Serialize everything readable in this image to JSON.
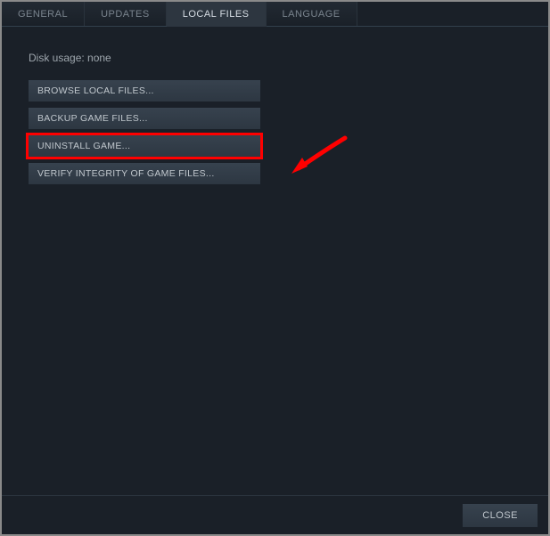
{
  "tabs": {
    "general": "GENERAL",
    "updates": "UPDATES",
    "local_files": "LOCAL FILES",
    "language": "LANGUAGE"
  },
  "disk_usage_label": "Disk usage: none",
  "buttons": {
    "browse": "BROWSE LOCAL FILES...",
    "backup": "BACKUP GAME FILES...",
    "uninstall": "UNINSTALL GAME...",
    "verify": "VERIFY INTEGRITY OF GAME FILES..."
  },
  "footer": {
    "close": "CLOSE"
  },
  "annotation": {
    "highlight_button": "uninstall",
    "arrow_color": "#ff0000"
  }
}
